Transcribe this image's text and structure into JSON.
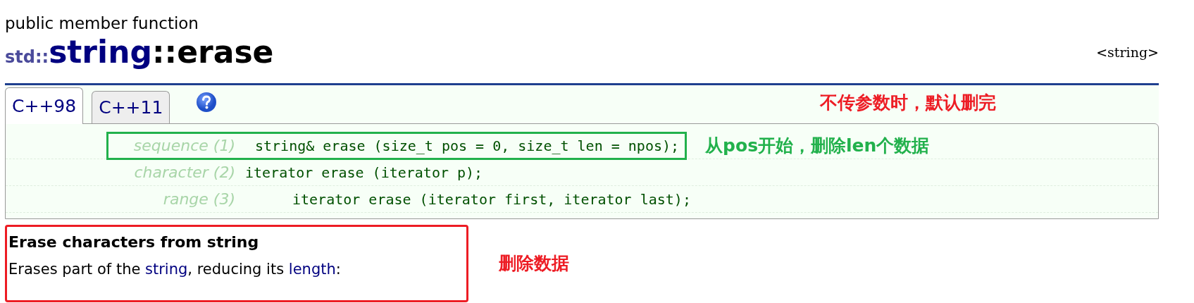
{
  "kind_label": "public member function",
  "title": {
    "namespace": "std::",
    "class": "string",
    "member": "::erase"
  },
  "header_tag": "<string>",
  "tabs": [
    {
      "label": "C++98",
      "selected": true
    },
    {
      "label": "C++11",
      "selected": false
    }
  ],
  "tab_note": {
    "text": "不传参数时，默认删完",
    "color": "#ed1c24"
  },
  "overloads": [
    {
      "label": "sequence (1)",
      "code": "string& erase (size_t pos = 0, size_t len = npos);",
      "highlighted": true,
      "note": {
        "text": "从pos开始，删除len个数据",
        "color": "#22b14c"
      }
    },
    {
      "label": "character (2)",
      "code": "iterator erase (iterator p);",
      "highlighted": false
    },
    {
      "label": "range (3)",
      "code": "iterator erase (iterator first, iterator last);",
      "highlighted": false
    }
  ],
  "description": {
    "heading": "Erase characters from string",
    "highlighted": true,
    "parts": [
      {
        "kind": "text",
        "text": "Erases part of the "
      },
      {
        "kind": "link",
        "text": "string"
      },
      {
        "kind": "text",
        "text": ", reducing its "
      },
      {
        "kind": "link",
        "text": "length"
      },
      {
        "kind": "text",
        "text": ":"
      }
    ],
    "note": {
      "text": "删除数据",
      "color": "#ed1c24"
    }
  }
}
